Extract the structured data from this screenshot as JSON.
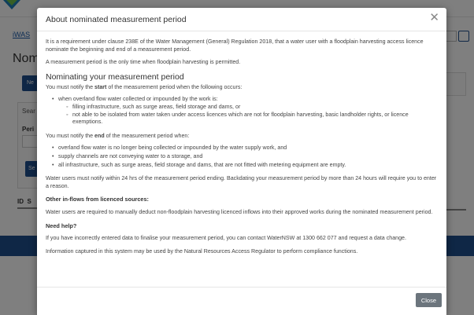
{
  "background": {
    "breadcrumb_link": "iWAS",
    "page_title": "Nom",
    "new_button": "Ne",
    "search_panel_label": "Sear",
    "period_label": "Peri",
    "search_button": "Se",
    "table_headers": [
      "ID",
      "S"
    ],
    "brand_color": "#1f4e8c"
  },
  "modal": {
    "title": "About nominated measurement period",
    "close_icon": "close-icon",
    "intro": "It is a requirement under clause 238E of the Water Management (General) Regulation 2018, that a water user with a floodplain harvesting access licence nominate the beginning and end of a measurement period.",
    "only_time": "A measurement period is the only time when floodplain harvesting is permitted.",
    "nominating_heading": "Nominating your measurement period",
    "start_pre": "You must notify the ",
    "start_bold": "start",
    "start_post": " of the measurement period when the following occurs:",
    "start_items": [
      {
        "text": "when overland flow water collected or impounded by the work is:",
        "sub": [
          "filling infrastructure, such as surge areas, field storage and dams, or",
          "not able to be isolated from water taken under access licences which are not for floodplain harvesting, basic landholder rights, or licence exemptions."
        ]
      }
    ],
    "end_pre": "You must notify the ",
    "end_bold": "end",
    "end_post": " of the measurement period when:",
    "end_items": [
      "overland flow water is no longer being collected or impounded by the water supply work, and",
      "supply channels are not conveying water to a storage, and",
      "all infrastructure, such as surge areas, field storage and dams, that are not fitted with metering equipment are empty."
    ],
    "notify_within": "Water users must notify within 24 hrs of the measurement period ending. Backdating your measurement period by more than 24 hours will require you to enter a reason.",
    "inflows_heading": "Other in-flows from licenced sources:",
    "inflows_text": "Water users are required to manually deduct non-floodplain harvesting licenced inflows into their approved works during the nominated measurement period.",
    "help_heading": "Need help?",
    "help_text": "If you have incorrectly entered data to finalise your measurement period, you can contact WaterNSW at 1300 662 077 and request a data change.",
    "info_text": "Information captured in this system may be used by the Natural Resources Access Regulator to perform compliance functions.",
    "close_button": "Close"
  }
}
